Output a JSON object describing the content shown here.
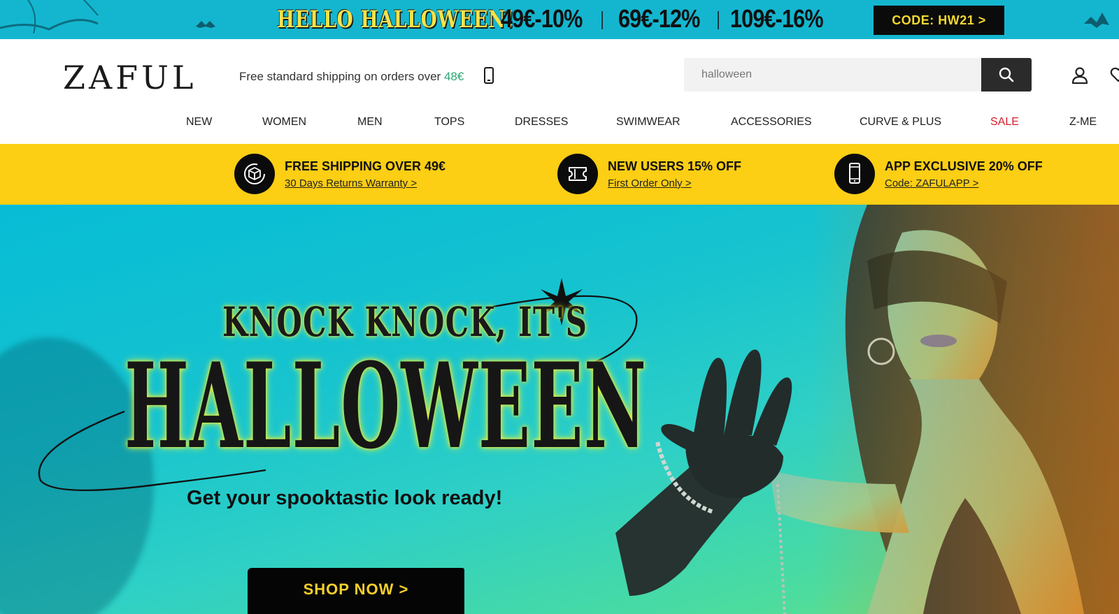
{
  "promo_strip": {
    "title": "HELLO HALLOWEEN!",
    "deals": [
      "49€-10%",
      "69€-12%",
      "109€-16%"
    ],
    "code_label": "CODE: HW21 >"
  },
  "header": {
    "logo": "ZAFUL",
    "shipping_text": "Free standard shipping on orders over ",
    "shipping_amount": "48€",
    "search": {
      "value": "halloween",
      "placeholder": "halloween"
    },
    "icons": [
      "phone-icon",
      "search-icon",
      "user-icon",
      "heart-icon"
    ]
  },
  "nav": {
    "items": [
      "NEW",
      "WOMEN",
      "MEN",
      "TOPS",
      "DRESSES",
      "SWIMWEAR",
      "ACCESSORIES",
      "CURVE & PLUS",
      "SALE",
      "Z-ME"
    ]
  },
  "perks": [
    {
      "title": "FREE SHIPPING OVER 49€",
      "sub": "30 Days Returns Warranty >",
      "icon": "box-icon"
    },
    {
      "title": "NEW USERS 15% OFF",
      "sub": "First Order Only >",
      "icon": "coupon-icon"
    },
    {
      "title": "APP EXCLUSIVE 20% OFF",
      "sub": "Code: ZAFULAPP >",
      "icon": "mobile-icon"
    }
  ],
  "hero": {
    "kicker": "KNOCK KNOCK, IT'S",
    "headline": "HALLOWEEN",
    "tagline": "Get your spooktastic look ready!",
    "cta": "SHOP NOW >"
  },
  "colors": {
    "promo_bg": "#14b6cf",
    "perks_bg": "#fcce14",
    "sale": "#d51e2a",
    "accent_green": "#2aa876",
    "cta_text": "#f4cf2d"
  }
}
